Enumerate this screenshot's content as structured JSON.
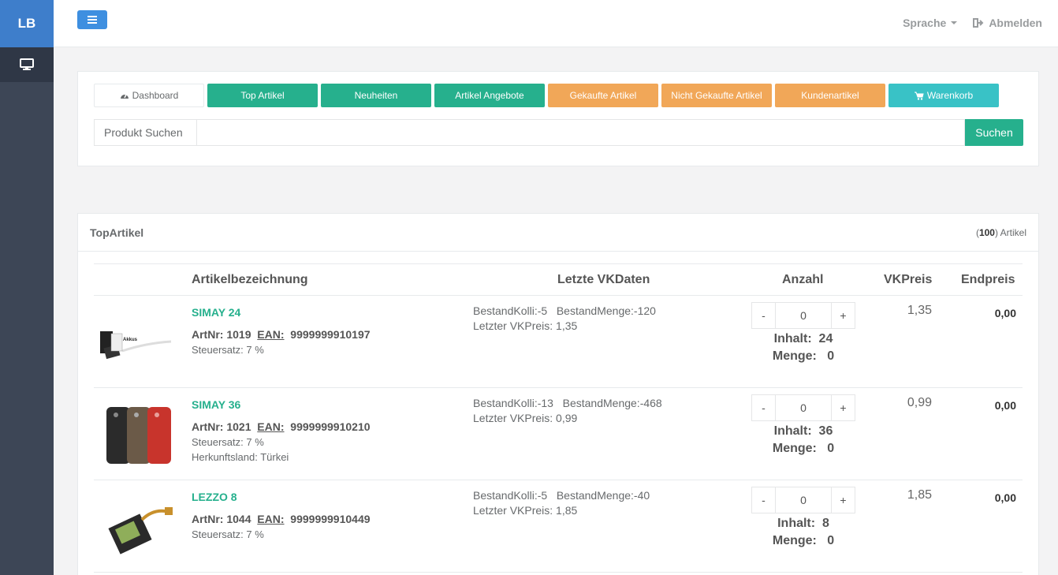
{
  "sidebar": {
    "brand": "LB",
    "items": [
      {
        "icon": "monitor-icon"
      }
    ]
  },
  "topbar": {
    "menu_icon": "hamburger-icon",
    "language": "Sprache",
    "logout": "Abmelden",
    "logout_icon": "sign-out-icon"
  },
  "nav": {
    "buttons": [
      {
        "label": "Dashboard",
        "icon": "dashboard-icon",
        "style": "plain"
      },
      {
        "label": "Top Artikel",
        "style": "green"
      },
      {
        "label": "Neuheiten",
        "style": "green"
      },
      {
        "label": "Artikel Angebote",
        "style": "green"
      },
      {
        "label": "Gekaufte Artikel",
        "style": "orange"
      },
      {
        "label": "Nicht Gekaufte Artikel",
        "style": "orange"
      },
      {
        "label": "Kundenartikel",
        "style": "orange"
      },
      {
        "label": "Warenkorb",
        "icon": "cart-icon",
        "style": "cyan"
      }
    ],
    "search_label": "Produkt Suchen",
    "search_value": "",
    "search_button": "Suchen"
  },
  "products": {
    "title": "TopArtikel",
    "count_open": "(",
    "count": "100",
    "count_close": ") Artikel",
    "columns": {
      "name": "Artikelbezeichnung",
      "vk": "Letzte VKDaten",
      "qty": "Anzahl",
      "vkpreis": "VKPreis",
      "endpreis": "Endpreis"
    },
    "rows": [
      {
        "name": "SIMAY 24",
        "artnr_label": "ArtNr:",
        "artnr": "1019",
        "ean_label": "EAN:",
        "ean": "9999999910197",
        "steuer": "Steuersatz: 7 %",
        "herkunft": "",
        "bestand": "BestandKolli:-5   BestandMenge:-120",
        "letzter": "Letzter VKPreis: 1,35",
        "qty": "0",
        "inhalt_label": "Inhalt:",
        "inhalt": "24",
        "menge_label": "Menge:",
        "menge": "0",
        "vkpreis": "1,35",
        "endpreis": "0,00",
        "thumb_label": "Akkus"
      },
      {
        "name": "SIMAY 36",
        "artnr_label": "ArtNr:",
        "artnr": "1021",
        "ean_label": "EAN:",
        "ean": "9999999910210",
        "steuer": "Steuersatz: 7 %",
        "herkunft": "Herkunftsland: Türkei",
        "bestand": "BestandKolli:-13   BestandMenge:-468",
        "letzter": "Letzter VKPreis: 0,99",
        "qty": "0",
        "inhalt_label": "Inhalt:",
        "inhalt": "36",
        "menge_label": "Menge:",
        "menge": "0",
        "vkpreis": "0,99",
        "endpreis": "0,00"
      },
      {
        "name": "LEZZO 8",
        "artnr_label": "ArtNr:",
        "artnr": "1044",
        "ean_label": "EAN:",
        "ean": "9999999910449",
        "steuer": "Steuersatz: 7 %",
        "herkunft": "",
        "bestand": "BestandKolli:-5   BestandMenge:-40",
        "letzter": "Letzter VKPreis: 1,85",
        "qty": "0",
        "inhalt_label": "Inhalt:",
        "inhalt": "8",
        "menge_label": "Menge:",
        "menge": "0",
        "vkpreis": "1,85",
        "endpreis": "0,00"
      }
    ],
    "stepper_minus": "-",
    "stepper_plus": "+"
  },
  "colors": {
    "green": "#26b08d",
    "orange": "#f1a758",
    "cyan": "#39c2c6",
    "blue": "#3e8fe0",
    "sidebar": "#3d4656"
  }
}
